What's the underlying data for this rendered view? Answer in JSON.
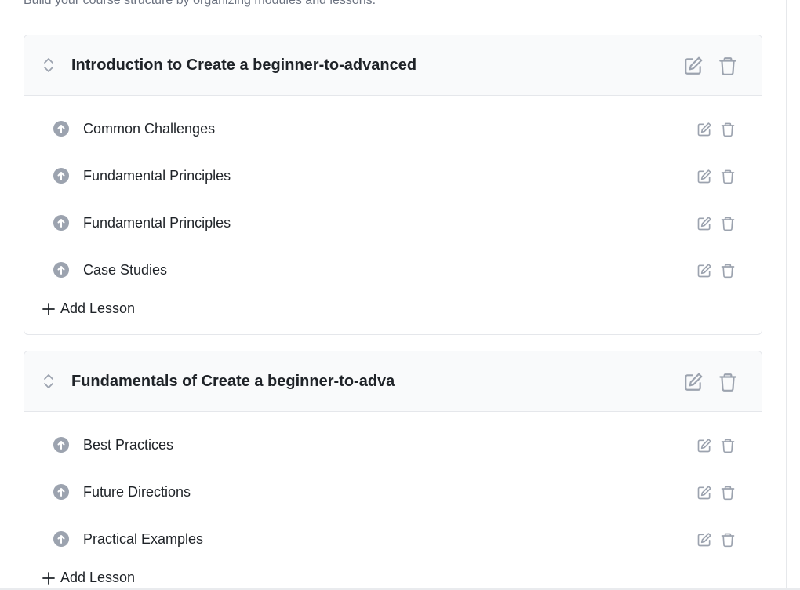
{
  "header": {
    "subtitle": "Build your course structure by organizing modules and lessons."
  },
  "modules": [
    {
      "title": "Introduction to Create a beginner-to-advanced",
      "lessons": [
        {
          "title": "Common Challenges"
        },
        {
          "title": "Fundamental Principles"
        },
        {
          "title": "Fundamental Principles"
        },
        {
          "title": "Case Studies"
        }
      ],
      "add_lesson_label": "Add Lesson"
    },
    {
      "title": "Fundamentals of Create a beginner-to-adva",
      "lessons": [
        {
          "title": "Best Practices"
        },
        {
          "title": "Future Directions"
        },
        {
          "title": "Practical Examples"
        }
      ],
      "add_lesson_label": "Add Lesson"
    }
  ],
  "icons": {
    "drag": "drag-handle-icon",
    "edit": "edit-icon",
    "delete": "trash-icon",
    "lesson": "arrow-up-circle-icon",
    "add": "plus-icon"
  },
  "colors": {
    "icon_gray": "#9ca3af",
    "header_bg": "#f9fafb",
    "border": "#e5e7eb",
    "text": "#1f2328",
    "muted": "#6b7280"
  }
}
